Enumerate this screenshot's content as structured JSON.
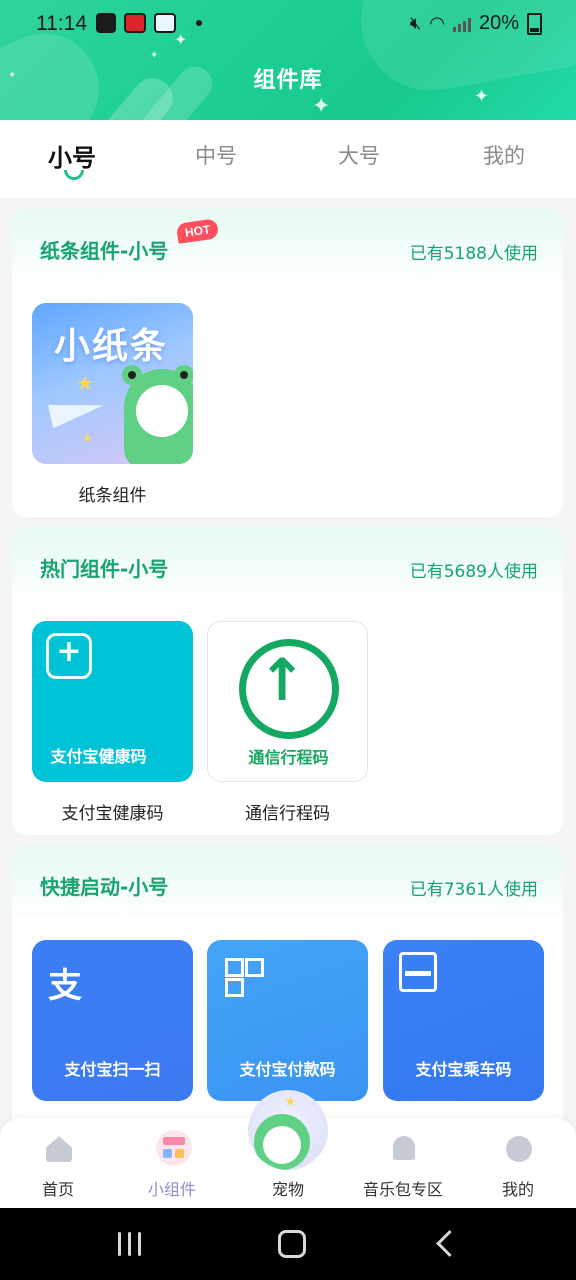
{
  "status_bar": {
    "time": "11:14",
    "battery": "20%"
  },
  "header": {
    "title": "组件库"
  },
  "tabs": [
    {
      "label": "小号",
      "active": true
    },
    {
      "label": "中号",
      "active": false
    },
    {
      "label": "大号",
      "active": false
    },
    {
      "label": "我的",
      "active": false
    }
  ],
  "sections": [
    {
      "title": "纸条组件-小号",
      "badge": "HOT",
      "count": "已有5188人使用",
      "items": [
        {
          "name": "纸条组件",
          "art_text": "小纸条"
        }
      ]
    },
    {
      "title": "热门组件-小号",
      "count": "已有5689人使用",
      "items": [
        {
          "name": "支付宝健康码",
          "tile_label": "支付宝健康码"
        },
        {
          "name": "通信行程码",
          "tile_label": "通信行程码"
        }
      ]
    },
    {
      "title": "快捷启动-小号",
      "count": "已有7361人使用",
      "items": [
        {
          "tile_label": "支付宝扫一扫"
        },
        {
          "tile_label": "支付宝付款码"
        },
        {
          "tile_label": "支付宝乘车码"
        }
      ]
    }
  ],
  "bottom_nav": [
    {
      "label": "首页",
      "icon": "home-icon"
    },
    {
      "label": "小组件",
      "icon": "widgets-icon",
      "active": true
    },
    {
      "label": "宠物",
      "icon": "pet-frog-icon"
    },
    {
      "label": "音乐包专区",
      "icon": "bell-icon"
    },
    {
      "label": "我的",
      "icon": "profile-icon"
    }
  ],
  "colors": {
    "accent": "#16a46f",
    "header_green": "#1fcf93",
    "nav_active": "#8e8cd6",
    "hot_badge": "#ff4f5e",
    "health_tile": "#00c3d8",
    "alipay_blue": "#3c7ef5"
  }
}
